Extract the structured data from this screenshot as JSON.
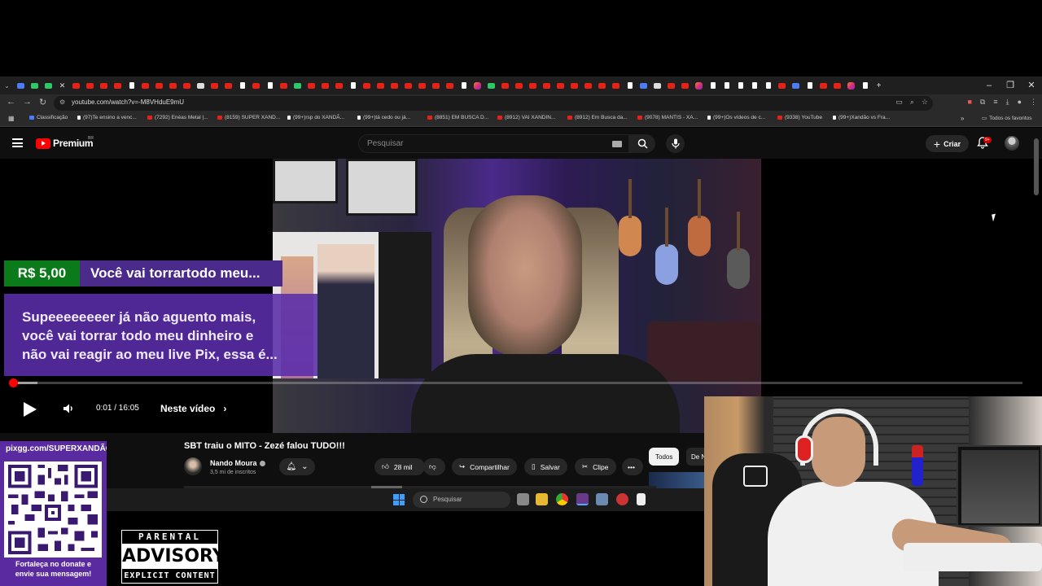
{
  "browser": {
    "url": "youtube.com/watch?v=-M8VHduE9mU",
    "bookmarks": [
      {
        "label": "Classificação",
        "icon": "bl"
      },
      {
        "label": "(97)Te ensino a venc...",
        "icon": "tt"
      },
      {
        "label": "(7292) Enéas Metal |...",
        "icon": "yt"
      },
      {
        "label": "(8159) SUPER XAND...",
        "icon": "yt"
      },
      {
        "label": "(99+)rsp do XANDÃ...",
        "icon": "tt"
      },
      {
        "label": "(99+)tá cedo ou já...",
        "icon": "tt"
      },
      {
        "label": "(8851) EM BUSCA D...",
        "icon": "yt"
      },
      {
        "label": "(8912) VAI XANDIN...",
        "icon": "yt"
      },
      {
        "label": "(8912) Em Busca da...",
        "icon": "yt"
      },
      {
        "label": "(9078) MANTIS - XA...",
        "icon": "yt"
      },
      {
        "label": "(99+)Os vídeos de c...",
        "icon": "tt"
      },
      {
        "label": "(9338) YouTube",
        "icon": "yt"
      },
      {
        "label": "(99+)Xandão vs Fra...",
        "icon": "tt"
      }
    ],
    "all_favorites": "Todos os favoritos"
  },
  "youtube": {
    "logo_text": "Premium",
    "region": "BR",
    "search_placeholder": "Pesquisar",
    "create_label": "Criar",
    "notifications_badge": "9+"
  },
  "player": {
    "time_current": "0:01",
    "time_total": "16:05",
    "time_text": "0:01 / 16:05",
    "progress_fraction": 0.001,
    "chapter_label": "Neste vídeo"
  },
  "superchat": {
    "amount": "R$ 5,00",
    "title": "Você vai torrartodo meu...",
    "body_lines": [
      "Supeeeeeeeer já não aguento mais,",
      "você vai torrar todo meu dinheiro e",
      "não vai reagir ao meu live Pix, essa é..."
    ]
  },
  "video": {
    "title": "SBT traiu o MITO - Zezé falou TUDO!!!",
    "channel": "Nando Moura",
    "subscribers": "3,5 mi de inscritos",
    "likes": "28 mil",
    "share_label": "Compartilhar",
    "save_label": "Salvar",
    "clip_label": "Clipe"
  },
  "chips": {
    "all": "Todos",
    "next": "De N"
  },
  "taskbar": {
    "search_placeholder": "Pesquisar"
  },
  "overlay": {
    "pix_url": "pixgg.com/SUPERXANDÃO",
    "pix_message_line1": "Fortaleça no donate e",
    "pix_message_line2": "envie sua mensagem!",
    "advisory_top": "PARENTAL",
    "advisory_mid": "ADVISORY",
    "advisory_bottom": "EXPLICIT CONTENT"
  },
  "colors": {
    "youtube_red": "#ff0000",
    "superchat_green": "#0a7a1a",
    "superchat_purple": "#5a2aa0"
  }
}
